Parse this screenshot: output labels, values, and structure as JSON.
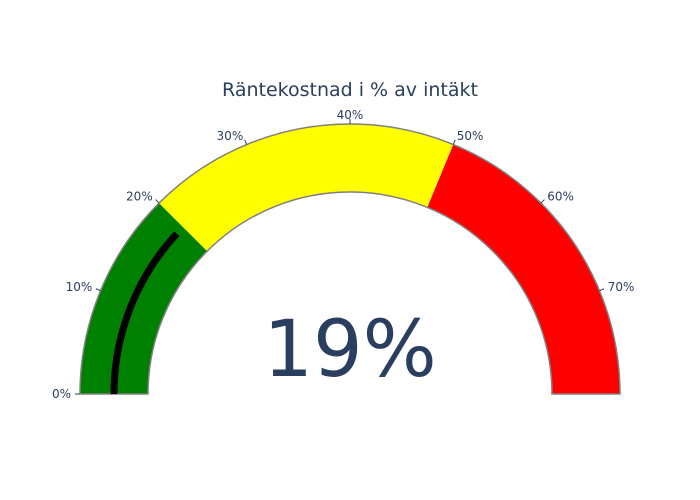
{
  "chart_data": {
    "type": "gauge",
    "title": "Räntekostnad i % av intäkt",
    "value": 19,
    "value_label": "19%",
    "range": [
      0,
      80
    ],
    "ticks": [
      0,
      10,
      20,
      30,
      40,
      50,
      60,
      70
    ],
    "tick_labels": [
      "0%",
      "10%",
      "20%",
      "30%",
      "40%",
      "50%",
      "60%",
      "70%"
    ],
    "steps": [
      {
        "range": [
          0,
          20
        ],
        "color": "#008000"
      },
      {
        "range": [
          20,
          50
        ],
        "color": "#ffff00"
      },
      {
        "range": [
          50,
          80
        ],
        "color": "#ff0000"
      }
    ],
    "bar_color": "#000000",
    "border_color": "#808080",
    "text_color": "#2a3f5f"
  }
}
